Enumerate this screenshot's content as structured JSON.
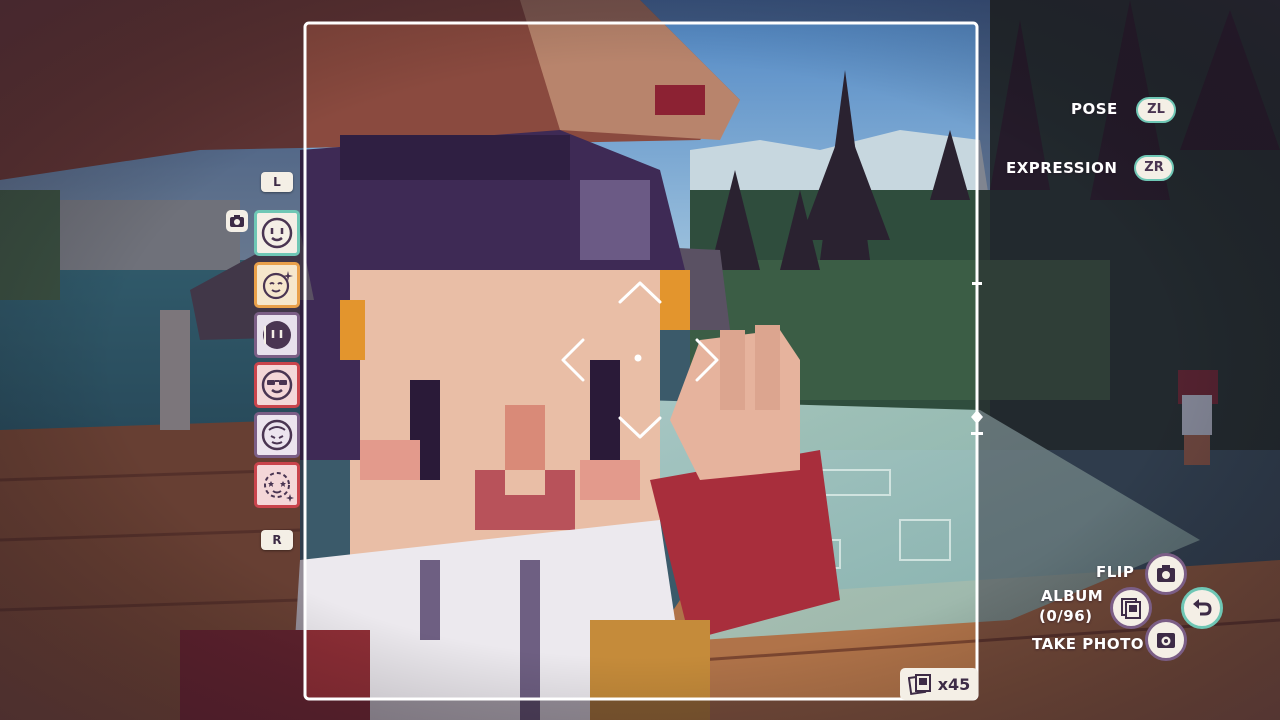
{
  "hud": {
    "pose_label": "POSE",
    "pose_button": "ZL",
    "expression_label": "EXPRESSION",
    "expression_button": "ZR",
    "expression_prev_key": "L",
    "expression_next_key": "R",
    "flip_label": "FLIP",
    "album_label": "ALBUM",
    "album_count": "(0/96)",
    "take_photo_label": "TAKE PHOTO",
    "film_remaining": "x45",
    "expressions": [
      {
        "icon": "smile-face-icon",
        "selected": true
      },
      {
        "icon": "sparkle-face-icon",
        "selected": false
      },
      {
        "icon": "gloomy-face-icon",
        "selected": false
      },
      {
        "icon": "sunglasses-face-icon",
        "selected": false
      },
      {
        "icon": "dizzy-face-icon",
        "selected": false
      },
      {
        "icon": "star-face-icon",
        "selected": false
      }
    ]
  },
  "colors": {
    "frame": "#ffffff",
    "accent_teal": "#6fc7b5",
    "accent_orange": "#e9a04a",
    "accent_purple": "#7b5e86",
    "accent_red": "#c9444c",
    "ui_cream": "#f4efe6"
  }
}
